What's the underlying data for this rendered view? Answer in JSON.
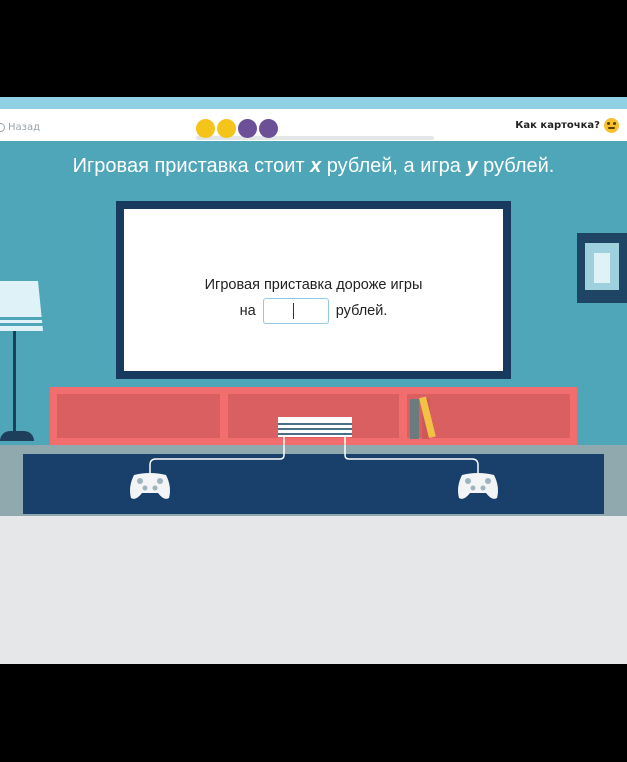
{
  "header": {
    "back_label": "Назад",
    "progress_dots": [
      "#f5c41b",
      "#f5c41b",
      "#6c4f97",
      "#6c4f97"
    ],
    "feedback_label": "Как карточка?"
  },
  "scene": {
    "question_part1": "Игровая приставка стоит ",
    "var_x": "x",
    "question_part2": " рублей, а игра ",
    "var_y": "y",
    "question_part3": " рублей."
  },
  "tv": {
    "task_line1": "Игровая приставка дороже игры",
    "task_prefix": "на",
    "task_suffix": "рублей.",
    "answer_value": ""
  },
  "colors": {
    "wall": "#4fa6b9",
    "tv_frame": "#173a5e",
    "shelf": "#f26d6d",
    "cabinet": "#19406a"
  }
}
